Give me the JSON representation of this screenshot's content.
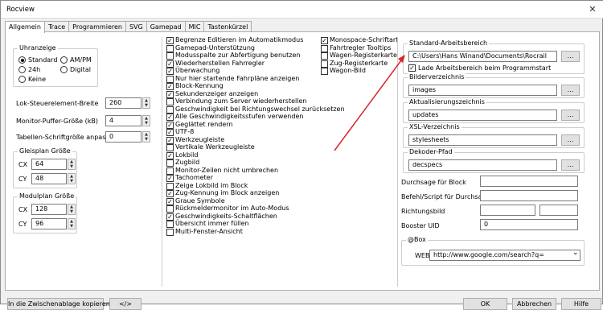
{
  "window": {
    "title": "Rocview",
    "close_glyph": "✕"
  },
  "tabs": [
    "Allgemein",
    "Trace",
    "Programmieren",
    "SVG",
    "Gamepad",
    "MIC",
    "Tastenkürzel"
  ],
  "uhrzeige": {
    "label": "Uhranzeige",
    "options": [
      "Standard",
      "AM/PM",
      "24h",
      "Digital",
      "Keine"
    ],
    "selected": "Standard"
  },
  "fields": {
    "lok_breite": {
      "label": "Lok-Steuerelement-Breite",
      "value": "260"
    },
    "monitor_puffer": {
      "label": "Monitor-Puffer-Größe (kB)",
      "value": "4"
    },
    "tabellen_schrift": {
      "label": "Tabellen-Schriftgröße anpassen",
      "value": "0"
    }
  },
  "gleisplan": {
    "label": "Gleisplan Größe",
    "cx_label": "CX",
    "cx": "64",
    "cy_label": "CY",
    "cy": "48"
  },
  "modulplan": {
    "label": "Modulplan Größe",
    "cx_label": "CX",
    "cx": "128",
    "cy_label": "CY",
    "cy": "96"
  },
  "checks_left": [
    {
      "label": "Begrenze Editieren im Automatikmodus",
      "checked": true
    },
    {
      "label": "Gamepad-Unterstützung",
      "checked": false
    },
    {
      "label": "Modusspalte zur Abfertigung benutzen",
      "checked": false
    },
    {
      "label": "Wiederherstellen Fahrregler",
      "checked": true
    },
    {
      "label": "Überwachung",
      "checked": true
    },
    {
      "label": "Nur hier startende Fahrpläne anzeigen",
      "checked": false
    },
    {
      "label": "Block-Kennung",
      "checked": true
    },
    {
      "label": "Sekundenzeiger anzeigen",
      "checked": true
    },
    {
      "label": "Verbindung zum Server wiederherstellen",
      "checked": false
    },
    {
      "label": "Geschwindigkeit bei Richtungswechsel zurücksetzen",
      "checked": false
    },
    {
      "label": "Alle Geschwindigkeitsstufen verwenden",
      "checked": true
    },
    {
      "label": "Geglättet rendern",
      "checked": true
    },
    {
      "label": "UTF-8",
      "checked": true
    },
    {
      "label": "Werkzeugleiste",
      "checked": true
    },
    {
      "label": "Vertikale Werkzeugleiste",
      "checked": false
    },
    {
      "label": "Lokbild",
      "checked": true
    },
    {
      "label": "Zugbild",
      "checked": false
    },
    {
      "label": "Monitor-Zeilen nicht umbrechen",
      "checked": false
    },
    {
      "label": "Tachometer",
      "checked": true
    },
    {
      "label": "Zeige Lokbild im Block",
      "checked": false
    },
    {
      "label": "Zug-Kennung im Block anzeigen",
      "checked": true
    },
    {
      "label": "Graue Symbole",
      "checked": true
    },
    {
      "label": "Rückmeldermonitor im Auto-Modus",
      "checked": false
    },
    {
      "label": "Geschwindigkeits-Schaltflächen",
      "checked": true
    },
    {
      "label": "Übersicht immer füllen",
      "checked": false
    },
    {
      "label": "Multi-Fenster-Ansicht",
      "checked": false
    }
  ],
  "checks_mid": [
    {
      "label": "Monospace-Schriftart",
      "checked": true
    },
    {
      "label": "Fahrtregler Tooltips",
      "checked": false
    },
    {
      "label": "Wagen-Registerkarte",
      "checked": false
    },
    {
      "label": "Zug-Registerkarte",
      "checked": false
    },
    {
      "label": "Wagon-Bild",
      "checked": false
    }
  ],
  "workspace": {
    "label": "Standard-Arbeitsbereich",
    "value": "C:\\Users\\Hans Winand\\Documents\\Rocrail",
    "browse": "...",
    "load_label": "Lade Arbeitsbereich beim Programmstart",
    "load_checked": true
  },
  "bilder": {
    "label": "Bilderverzeichnis",
    "value": "images",
    "browse": "..."
  },
  "updates": {
    "label": "Aktualisierungszeichnis",
    "value": "updates",
    "browse": "..."
  },
  "xsl": {
    "label": "XSL-Verzeichnis",
    "value": "stylesheets",
    "browse": "..."
  },
  "dekoder": {
    "label": "Dekoder-Pfad",
    "value": "decspecs",
    "browse": "..."
  },
  "durchsage": {
    "label": "Durchsage für Block",
    "value": ""
  },
  "befehl": {
    "label": "Befehl/Script für Durchsage",
    "value": ""
  },
  "richtungsbild": {
    "label": "Richtungsbild",
    "value1": "",
    "value2": ""
  },
  "booster": {
    "label": "Booster UID",
    "value": "0"
  },
  "box": {
    "label": "@Box",
    "web_label": "WEB",
    "url": "http://www.google.com/search?q=",
    "dropdown_glyph": "⌄"
  },
  "footer": {
    "clipboard": "In die Zwischenablage kopieren",
    "code": "</>",
    "ok": "OK",
    "abbrechen": "Abbrechen",
    "hilfe": "Hilfe"
  },
  "colors": {
    "accent_arrow": "#d9262a",
    "window_bg": "#f0f0f0"
  }
}
